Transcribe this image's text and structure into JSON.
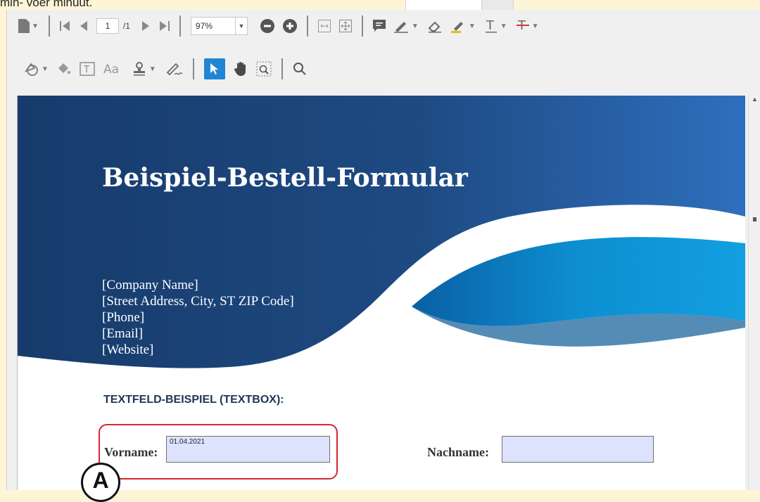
{
  "caption": "min- voer minuut.",
  "toolbar": {
    "page_current": "1",
    "page_total": "/1",
    "zoom": "97%"
  },
  "document": {
    "title": "Beispiel-Bestell-Formular",
    "company_lines": [
      "[Company Name]",
      "[Street Address, City, ST ZIP Code]",
      "[Phone]",
      "[Email]",
      "[Website]"
    ],
    "section_label": "TEXTFELD-BEISPIEL (TEXTBOX):",
    "fields": {
      "vorname_label": "Vorname:",
      "vorname_value": "01.04.2021",
      "nachname_label": "Nachname:",
      "nachname_value": ""
    }
  },
  "annotation": {
    "marker": "A",
    "color": "#d7262e"
  },
  "colors": {
    "wave_dark": "#1c4274",
    "wave_mid": "#2e6db1",
    "wave_light": "#0f9ad8",
    "select_accent": "#1f86d6"
  }
}
